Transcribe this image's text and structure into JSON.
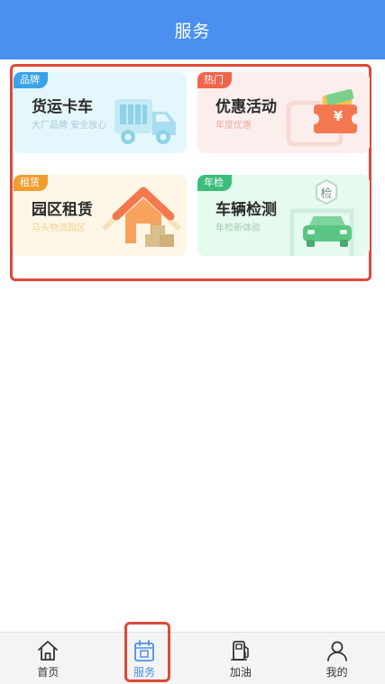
{
  "header": {
    "title": "服务"
  },
  "cards": {
    "truck": {
      "tag": "品牌",
      "title": "货运卡车",
      "subtitle": "大厂品牌 安全放心"
    },
    "promo": {
      "tag": "热门",
      "title": "优惠活动",
      "subtitle": "年度优惠",
      "coupon_symbol": "¥"
    },
    "park": {
      "tag": "租赁",
      "title": "园区租赁",
      "subtitle": "马头物流园区"
    },
    "inspect": {
      "tag": "年检",
      "title": "车辆检测",
      "subtitle": "年检新体验",
      "badge": "检"
    }
  },
  "tabbar": {
    "active": "services",
    "items": [
      {
        "id": "home",
        "label": "首页",
        "icon": "home-icon"
      },
      {
        "id": "services",
        "label": "服务",
        "icon": "services-icon"
      },
      {
        "id": "fuel",
        "label": "加油",
        "icon": "fuel-pump-icon"
      },
      {
        "id": "mine",
        "label": "我的",
        "icon": "user-icon"
      }
    ]
  },
  "colors": {
    "header": "#4b8ff0",
    "highlight": "#e0483a",
    "active_tab": "#4b8ff0"
  }
}
